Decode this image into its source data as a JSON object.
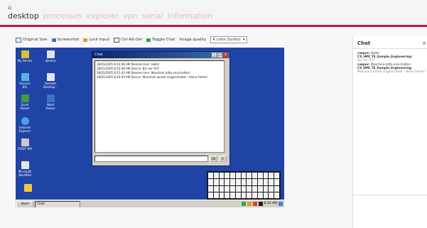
{
  "header": {
    "home_icon": "home-icon",
    "nav": [
      "desktop",
      "processes",
      "explorer",
      "vpn",
      "serial",
      "information"
    ],
    "accent_color": "#c2185b"
  },
  "toolbar": {
    "items": [
      {
        "icon": "original-size-icon",
        "label": "Original Size"
      },
      {
        "icon": "screenshot-icon",
        "label": "Screenshot"
      },
      {
        "icon": "lock-icon",
        "label": "Lock Input"
      },
      {
        "icon": "ctrl-alt-del-icon",
        "label": "Ctrl-Alt-Del"
      },
      {
        "icon": "chat-icon",
        "label": "Toggle Chat"
      }
    ],
    "quality_label": "Image quality",
    "quality_value": "4 color (turbo)"
  },
  "remote": {
    "desktop_icons": [
      "My Device",
      "ejkemo",
      "Recycle Bin",
      "Remote Desktop...",
      "Excel Viewer",
      "Word Viewer",
      "Internet Explorer",
      "EVIDT HM",
      "Microsoft WordPad"
    ],
    "chat_window": {
      "title": "Chat",
      "log": [
        "18/01/2005 8:14:48 AM Remote User: Hallo!",
        "18/01/2005 8:15:08 AM Device: Bin vor Ort!",
        "18/01/2005 8:15:42 AM Remote User: Maschine bitte einschalten!",
        "18/01/2005 8:16:09 AM Device: Maschine wurde eingeschaltet – Keine Fehler!"
      ],
      "ok_label": "OK",
      "x_label": "X"
    },
    "taskbar": {
      "start_label": "Start",
      "task_label": "Chat",
      "clock": "8:16 AM"
    }
  },
  "chat_panel": {
    "title": "Chat",
    "close": "×",
    "messages": [
      {
        "from": "rueper:",
        "text": "Hallo!"
      },
      {
        "from": "CX_HMI_TE_Sample_Engineering:",
        "text": "Bin vor Ort!"
      },
      {
        "from": "rueper:",
        "text": "Maschine bitte einschalten"
      },
      {
        "from": "CX_HMI_TE_Sample_Engineering:",
        "text": "Maschine wurde eingeschaltet – Keine Fehler!"
      }
    ]
  }
}
